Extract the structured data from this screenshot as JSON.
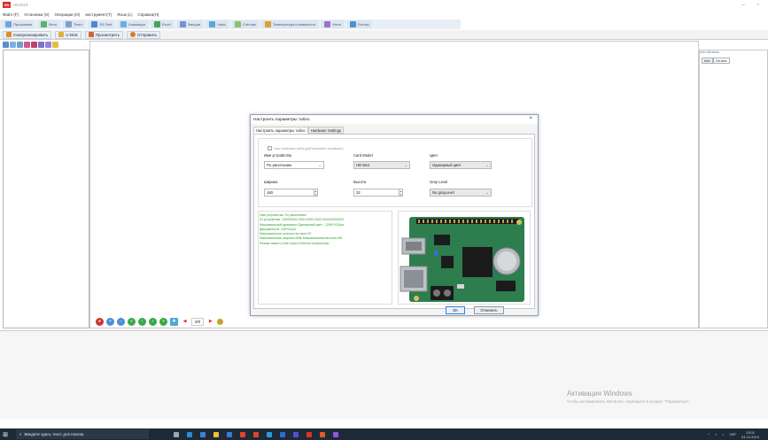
{
  "app": {
    "title": "HD2018",
    "logo_text": "HD"
  },
  "menu": [
    "Файл (F)",
    "Установки (S)",
    "Операции (O)",
    "инструмент(T)",
    "Язык (L)",
    "Справка(H)"
  ],
  "toolbar1": [
    "Программа",
    "Фото",
    "Текст",
    "3D-Text",
    "Анимация",
    "Excel",
    "Эмоции",
    "Часы",
    "Счётчик",
    "Температура и влажность",
    "Неон",
    "Лоттер"
  ],
  "toolbar2": {
    "sync": "Синхронизировать",
    "udisk": "U-Disk",
    "preview": "Просмотреть",
    "send": "Отправить"
  },
  "right_panel": {
    "title": "Info Window",
    "tabs": [
      "Info",
      "On-line"
    ]
  },
  "playback": {
    "page_indicator": "0/0"
  },
  "dialog": {
    "title": "Настроить параметры табло",
    "close": "×",
    "tabs": [
      "Настроить параметры табло",
      "Hardware Settings"
    ],
    "use_hw_label": "Use hardware settings(Parameter readback)",
    "device_name_label": "Имя устройства",
    "device_name_value": "По умолчанию",
    "card_model_label": "Card Model",
    "card_model_value": "HD-E64",
    "color_label": "Цвет",
    "color_value": "Одинарный цвет",
    "width_label": "Ширина",
    "width_value": "160",
    "height_label": "Высота",
    "height_value": "32",
    "gray_label": "Gray Level",
    "gray_value": "No grayLevel",
    "info_lines": [
      "Имя устройства: По умолчанию",
      "ID устройства: -00000000-0000-0000-0000-000000000000",
      "Максимальный диапазон:Одинарный цвет :-1256*1024px",
      "Двухцветный:-128*512px",
      "Максимальное количество окон:20",
      "Максимальная ширина:4096 Максимальная высота:256",
      "Режим связи:U-Disk через Ethernet контроллер"
    ],
    "ok": "OK",
    "cancel": "Отменить"
  },
  "activation": {
    "title": "Активация Windows",
    "subtitle": "Чтобы активировать Windows, перейдите в раздел \"Параметры\"."
  },
  "taskbar": {
    "search_placeholder": "Введите здесь текст для поиска",
    "lang": "УКР",
    "time": "13:02",
    "date": "04.10.2019"
  },
  "colors": {
    "accent": "#3c7fd4",
    "info_text": "#2e9e2e",
    "taskbar": "#1f2a38",
    "pcb": "#2e7d4f"
  }
}
